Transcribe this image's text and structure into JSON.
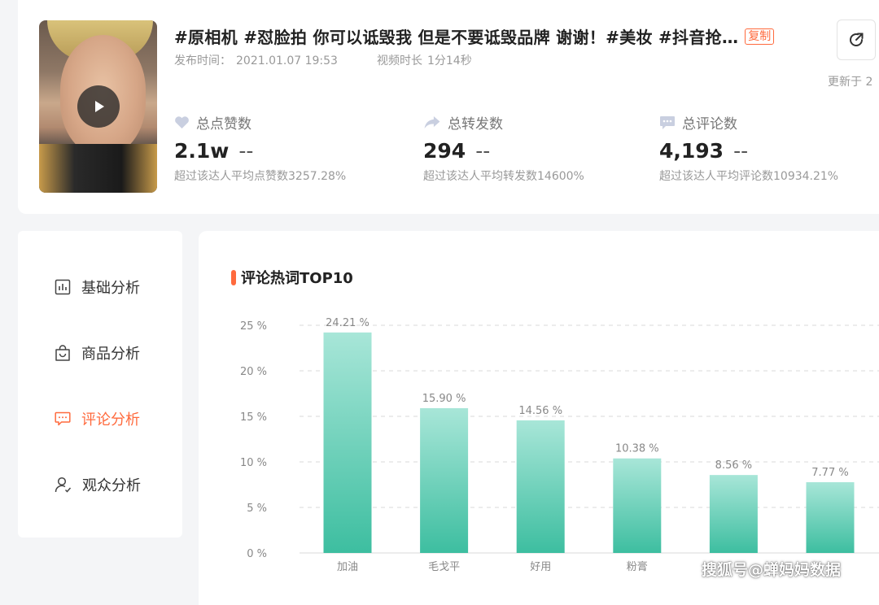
{
  "video": {
    "title": "#原相机 #怼脸拍 你可以诋毁我 但是不要诋毁品牌 谢谢！#美妆 #抖音抢…",
    "copy_label": "复制",
    "publish_label": "发布时间：",
    "publish_time": "2021.01.07 19:53",
    "duration_label": "视频时长",
    "duration": "1分14秒",
    "updated_label": "更新于 2"
  },
  "stats": [
    {
      "label": "总点赞数",
      "value": "2.1w",
      "trend": "--",
      "note": "超过该达人平均点赞数3257.28%",
      "icon": "heart-icon"
    },
    {
      "label": "总转发数",
      "value": "294",
      "trend": "--",
      "note": "超过该达人平均转发数14600%",
      "icon": "share-icon"
    },
    {
      "label": "总评论数",
      "value": "4,193",
      "trend": "--",
      "note": "超过该达人平均评论数10934.21%",
      "icon": "comment-icon"
    }
  ],
  "sidebar": {
    "items": [
      {
        "label": "基础分析",
        "icon": "bar-chart-icon",
        "active": false
      },
      {
        "label": "商品分析",
        "icon": "shopping-bag-icon",
        "active": false
      },
      {
        "label": "评论分析",
        "icon": "comment-icon",
        "active": true
      },
      {
        "label": "观众分析",
        "icon": "user-icon",
        "active": false
      }
    ]
  },
  "section": {
    "title": "评论热词TOP10"
  },
  "colors": {
    "accent": "#ff6a3d",
    "bar_top": "#a8e6d8",
    "bar_bottom": "#3dbea0"
  },
  "chart_data": {
    "type": "bar",
    "categories": [
      "加油",
      "毛戈平",
      "好用",
      "粉膏",
      "",
      ""
    ],
    "values": [
      24.21,
      15.9,
      14.56,
      10.38,
      8.56,
      7.77
    ],
    "value_labels": [
      "24.21 %",
      "15.90 %",
      "14.56 %",
      "10.38 %",
      "8.56 %",
      "7.77 %"
    ],
    "yticks": [
      "0 %",
      "5 %",
      "10 %",
      "15 %",
      "20 %",
      "25 %"
    ],
    "ylim": [
      0,
      25
    ],
    "grid": true
  },
  "watermark": "搜狐号@蝉妈妈数据"
}
